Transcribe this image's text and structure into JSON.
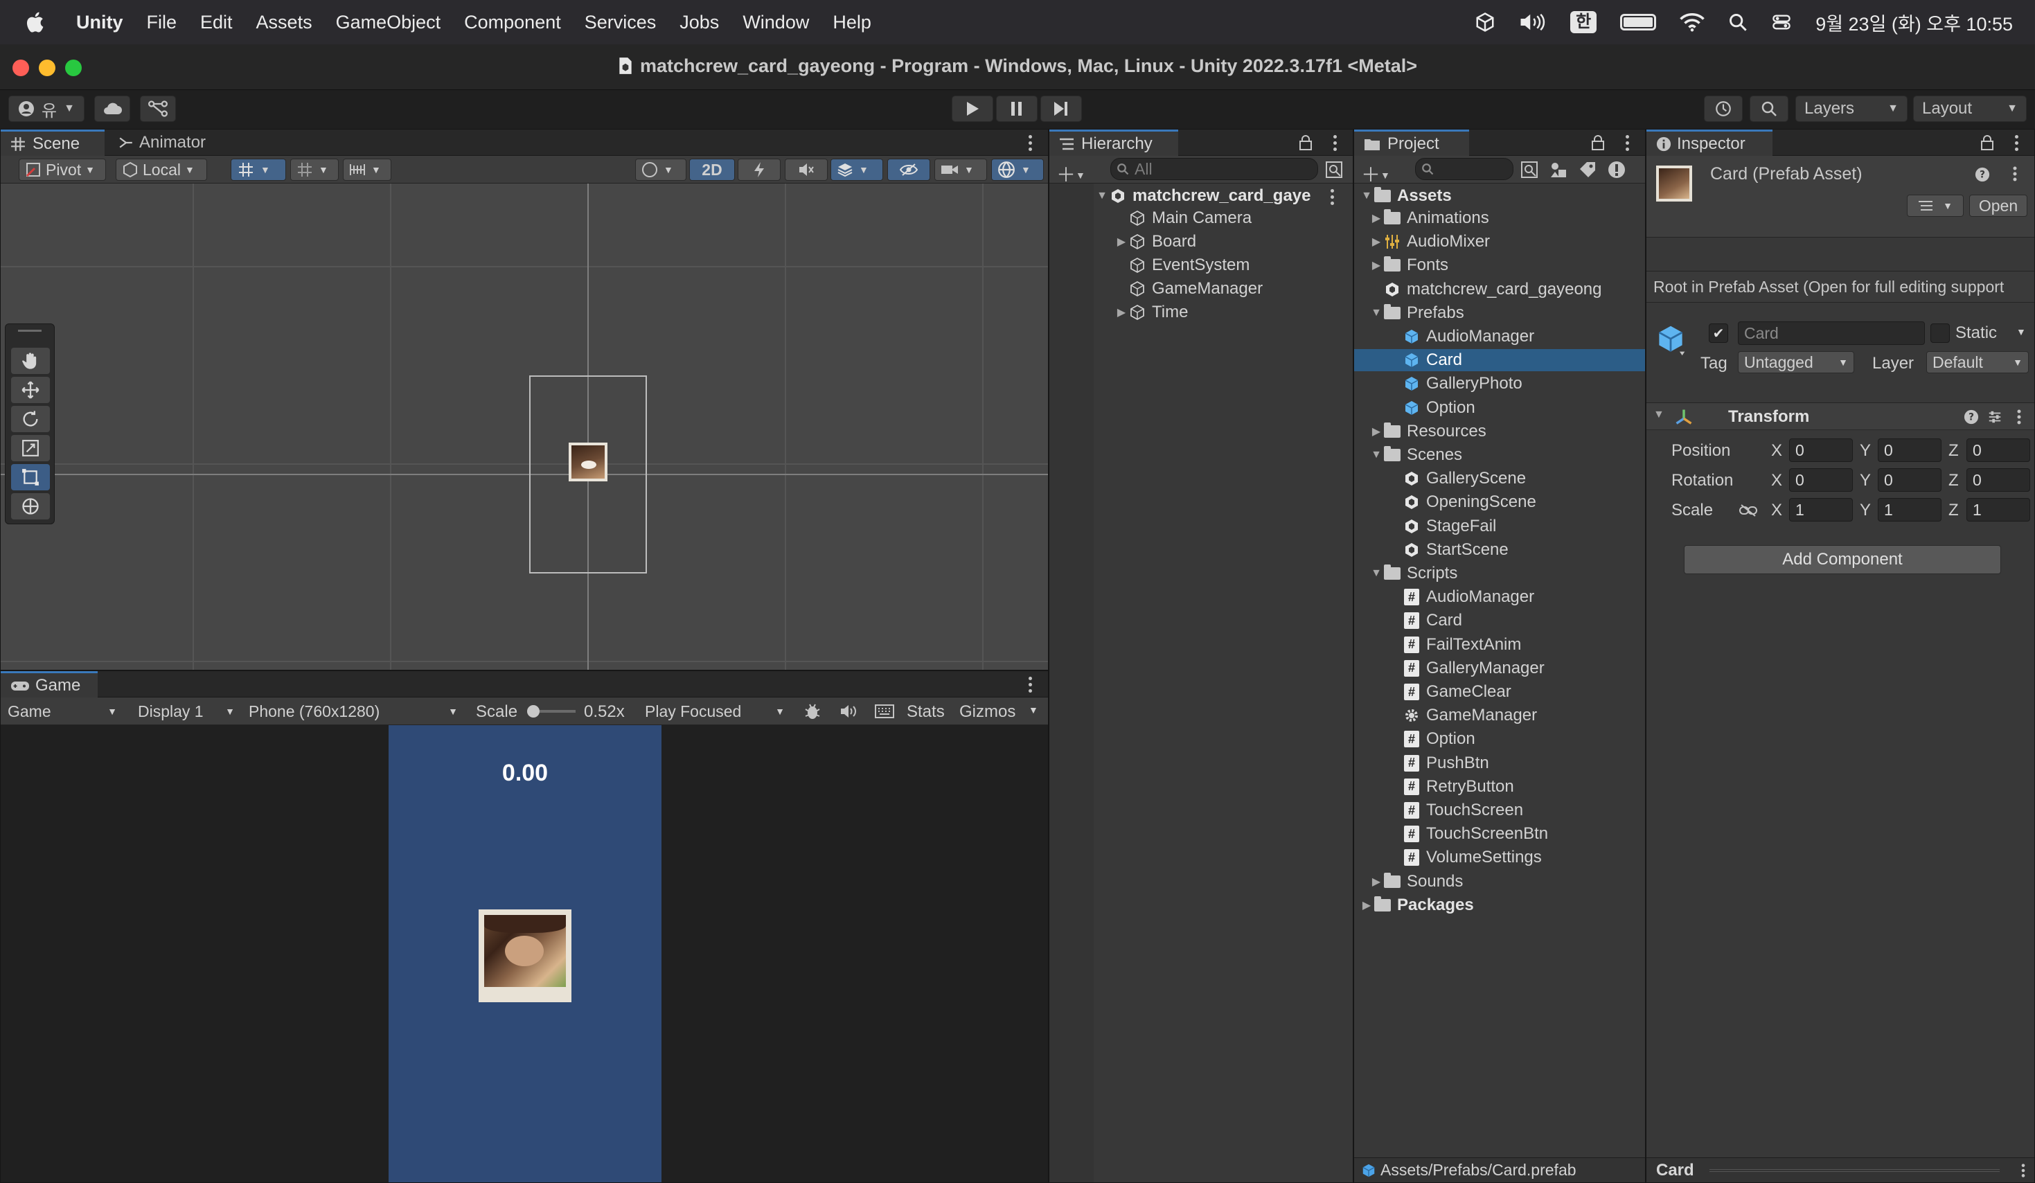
{
  "menubar": {
    "app": "Unity",
    "items": [
      "File",
      "Edit",
      "Assets",
      "GameObject",
      "Component",
      "Services",
      "Jobs",
      "Window",
      "Help"
    ],
    "input_indicator": "한",
    "clock": "9월 23일 (화) 오후 10:55"
  },
  "window": {
    "title": "matchcrew_card_gayeong - Program - Windows, Mac, Linux - Unity 2022.3.17f1 <Metal>"
  },
  "toolbar": {
    "account_label": "유",
    "layers_label": "Layers",
    "layout_label": "Layout"
  },
  "scene_panel": {
    "tabs": [
      "Scene",
      "Animator"
    ],
    "pivot_label": "Pivot",
    "local_label": "Local",
    "mode_2d": "2D"
  },
  "game_panel": {
    "tab": "Game",
    "view_select": "Game",
    "display_select": "Display 1",
    "resolution_select": "Phone (760x1280)",
    "scale_label": "Scale",
    "scale_value": "0.52x",
    "play_mode": "Play Focused",
    "stats_label": "Stats",
    "gizmos_label": "Gizmos",
    "timer_text": "0.00"
  },
  "hierarchy": {
    "tab": "Hierarchy",
    "search_placeholder": "All",
    "scene_name": "matchcrew_card_gaye",
    "items": [
      {
        "label": "Main Camera",
        "expandable": false
      },
      {
        "label": "Board",
        "expandable": true
      },
      {
        "label": "EventSystem",
        "expandable": false
      },
      {
        "label": "GameManager",
        "expandable": false
      },
      {
        "label": "Time",
        "expandable": true
      }
    ]
  },
  "project": {
    "tab": "Project",
    "root": "Assets",
    "tree": [
      {
        "label": "Animations",
        "level": 1,
        "icon": "folder",
        "arrow": "right"
      },
      {
        "label": "AudioMixer",
        "level": 1,
        "icon": "mixer",
        "arrow": "right"
      },
      {
        "label": "Fonts",
        "level": 1,
        "icon": "folder",
        "arrow": "right"
      },
      {
        "label": "matchcrew_card_gayeong",
        "level": 1,
        "icon": "scene",
        "arrow": ""
      },
      {
        "label": "Prefabs",
        "level": 1,
        "icon": "folder-open",
        "arrow": "down"
      },
      {
        "label": "AudioManager",
        "level": 2,
        "icon": "prefab",
        "arrow": ""
      },
      {
        "label": "Card",
        "level": 2,
        "icon": "prefab",
        "arrow": "",
        "selected": true
      },
      {
        "label": "GalleryPhoto",
        "level": 2,
        "icon": "prefab",
        "arrow": ""
      },
      {
        "label": "Option",
        "level": 2,
        "icon": "prefab",
        "arrow": ""
      },
      {
        "label": "Resources",
        "level": 1,
        "icon": "folder",
        "arrow": "right"
      },
      {
        "label": "Scenes",
        "level": 1,
        "icon": "folder-open",
        "arrow": "down"
      },
      {
        "label": "GalleryScene",
        "level": 2,
        "icon": "scene",
        "arrow": ""
      },
      {
        "label": "OpeningScene",
        "level": 2,
        "icon": "scene",
        "arrow": ""
      },
      {
        "label": "StageFail",
        "level": 2,
        "icon": "scene",
        "arrow": ""
      },
      {
        "label": "StartScene",
        "level": 2,
        "icon": "scene",
        "arrow": ""
      },
      {
        "label": "Scripts",
        "level": 1,
        "icon": "folder-open",
        "arrow": "down"
      },
      {
        "label": "AudioManager",
        "level": 2,
        "icon": "script",
        "arrow": ""
      },
      {
        "label": "Card",
        "level": 2,
        "icon": "script",
        "arrow": ""
      },
      {
        "label": "FailTextAnim",
        "level": 2,
        "icon": "script",
        "arrow": ""
      },
      {
        "label": "GalleryManager",
        "level": 2,
        "icon": "script",
        "arrow": ""
      },
      {
        "label": "GameClear",
        "level": 2,
        "icon": "script",
        "arrow": ""
      },
      {
        "label": "GameManager",
        "level": 2,
        "icon": "gear",
        "arrow": ""
      },
      {
        "label": "Option",
        "level": 2,
        "icon": "script",
        "arrow": ""
      },
      {
        "label": "PushBtn",
        "level": 2,
        "icon": "script",
        "arrow": ""
      },
      {
        "label": "RetryButton",
        "level": 2,
        "icon": "script",
        "arrow": ""
      },
      {
        "label": "TouchScreen",
        "level": 2,
        "icon": "script",
        "arrow": ""
      },
      {
        "label": "TouchScreenBtn",
        "level": 2,
        "icon": "script",
        "arrow": ""
      },
      {
        "label": "VolumeSettings",
        "level": 2,
        "icon": "script",
        "arrow": ""
      },
      {
        "label": "Sounds",
        "level": 1,
        "icon": "folder",
        "arrow": "right"
      }
    ],
    "packages": "Packages",
    "status_path": "Assets/Prefabs/Card.prefab"
  },
  "inspector": {
    "tab": "Inspector",
    "asset_title": "Card (Prefab Asset)",
    "open_button": "Open",
    "root_note": "Root in Prefab Asset (Open for full editing support",
    "object_name": "Card",
    "static_label": "Static",
    "tag_label": "Tag",
    "tag_value": "Untagged",
    "layer_label": "Layer",
    "layer_value": "Default",
    "transform": {
      "title": "Transform",
      "rows": [
        {
          "label": "Position",
          "x": "0",
          "y": "0",
          "z": "0"
        },
        {
          "label": "Rotation",
          "x": "0",
          "y": "0",
          "z": "0"
        },
        {
          "label": "Scale",
          "x": "1",
          "y": "1",
          "z": "1"
        }
      ]
    },
    "add_component": "Add Component",
    "footer": "Card"
  },
  "colors": {
    "accent": "#3a79bb",
    "selection": "#2c5d87",
    "game_background": "#2f4a76",
    "panel": "#383838"
  }
}
